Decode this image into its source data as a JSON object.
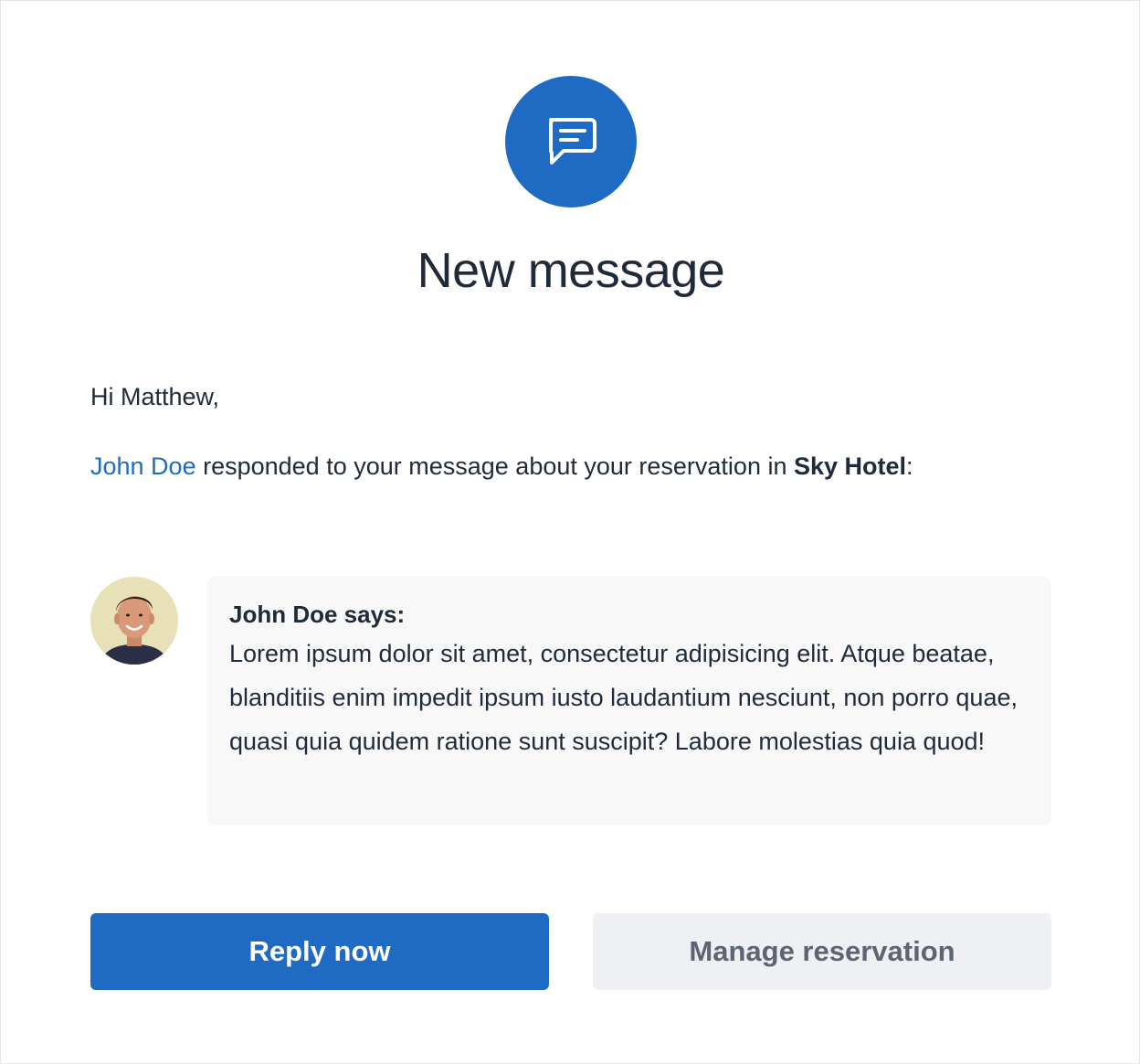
{
  "header": {
    "icon": "chat-bubble-icon",
    "title": "New message"
  },
  "email": {
    "greeting": "Hi Matthew,",
    "intro": {
      "sender_name": "John Doe",
      "text_middle": " responded to your message about your reservation in ",
      "hotel_name": "Sky Hotel",
      "text_end": ":"
    }
  },
  "message": {
    "author_line": "John Doe says:",
    "body": "Lorem ipsum dolor sit amet, consectetur adipisicing elit. Atque beatae, blanditiis enim impedit ipsum iusto laudantium nesciunt, non porro quae, quasi quia quidem ratione sunt suscipit? Labore molestias quia quod!"
  },
  "actions": {
    "reply_label": "Reply now",
    "manage_label": "Manage reservation"
  },
  "colors": {
    "accent": "#1f6bc4",
    "text": "#1f2a3a",
    "bubble_bg": "#f8f8f9",
    "secondary_button_bg": "#eef0f3",
    "secondary_button_text": "#5d6472"
  }
}
